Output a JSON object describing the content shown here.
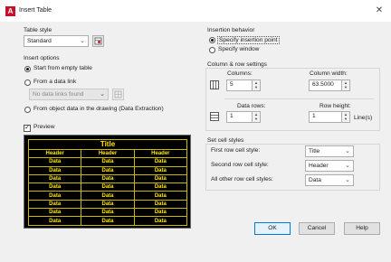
{
  "window": {
    "title": "Insert Table",
    "app_icon_letter": "A"
  },
  "table_style": {
    "label": "Table style",
    "value": "Standard"
  },
  "insert_options": {
    "label": "Insert options",
    "start_empty": "Start from empty table",
    "from_data_link": "From a data link",
    "data_link_value": "No data links found",
    "from_object_data": "From object data in the drawing (Data Extraction)",
    "selected": "start_empty"
  },
  "preview": {
    "label": "Preview",
    "checked": true,
    "title": "Title",
    "headers": [
      "Header",
      "Header",
      "Header"
    ],
    "rows": [
      [
        "Data",
        "Data",
        "Data"
      ],
      [
        "Data",
        "Data",
        "Data"
      ],
      [
        "Data",
        "Data",
        "Data"
      ],
      [
        "Data",
        "Data",
        "Data"
      ],
      [
        "Data",
        "Data",
        "Data"
      ],
      [
        "Data",
        "Data",
        "Data"
      ],
      [
        "Data",
        "Data",
        "Data"
      ],
      [
        "Data",
        "Data",
        "Data"
      ]
    ],
    "colors": {
      "background": "#000000",
      "text": "#ffe600"
    }
  },
  "insertion_behavior": {
    "label": "Insertion behavior",
    "specify_point": "Specify insertion point",
    "specify_window": "Specify window",
    "selected": "specify_point"
  },
  "column_row": {
    "label": "Column & row settings",
    "columns_label": "Columns:",
    "columns_value": "5",
    "column_width_label": "Column width:",
    "column_width_value": "63.5000",
    "data_rows_label": "Data rows:",
    "data_rows_value": "1",
    "row_height_label": "Row height:",
    "row_height_value": "1",
    "row_height_unit": "Line(s)"
  },
  "cell_styles": {
    "label": "Set cell styles",
    "first_row_label": "First row cell style:",
    "first_row_value": "Title",
    "second_row_label": "Second row cell style:",
    "second_row_value": "Header",
    "other_rows_label": "All other row cell styles:",
    "other_rows_value": "Data"
  },
  "buttons": {
    "ok": "OK",
    "cancel": "Cancel",
    "help": "Help"
  }
}
